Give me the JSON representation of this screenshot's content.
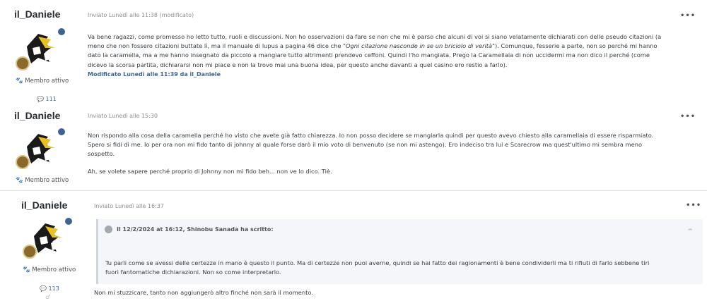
{
  "posts": [
    {
      "author": "il_Daniele",
      "group": "Membro attivo",
      "count": "111",
      "meta": "Inviato Lunedì alle 11:38 (modificato)",
      "paragraph1_a": "Va bene ragazzi, come promesso ho letto tutto, ruoli e discussioni. Non ho osservazioni da fare se non che mi è parso che alcuni di voi si siano velatamente dichiarati con delle pseudo citazioni (a",
      "paragraph1_b": "meno che non fossero citazioni buttate lì, ma il manuale di lupus a pagina 46 dice che \"",
      "paragraph1_italic": "Ogni citazione nasconde in se un briciolo di verità",
      "paragraph1_c": "\"). Comunque, fesserie a parte, non so perché mi hanno",
      "paragraph1_d": "dato la caramella, ma a me hanno insegnato da piccolo a mangiare tutto altrimenti prendevo ceffoni. Quindi l'ho mangiata. Prego la Caramellaia di non uccidermi ma non dico il perché (come",
      "paragraph1_e": "dicevo la scorsa partita, dichiararsi non mi piace e non la trovo mai una buona idea, per questo anche davanti a quel casino ero restio a farlo).",
      "modified": "Modificato Lunedì alle 11:39 da il_Daniele"
    },
    {
      "author": "il_Daniele",
      "group": "Membro attivo",
      "meta": "Inviato Lunedì alle 15:30",
      "line1": "Non rispondo alla cosa della caramella perché ho visto che avete già fatto chiarezza. Io non posso decidere se mangiarla quindi per questo avevo chiesto alla caramellaia di essere risparmiato.",
      "line2": "Spero si fidi di me. Io per ora non mi fido tanto di johnny al quale forse darò il mio voto di benvenuto (se non mi astengo). Ero indeciso tra lui e Scarecrow ma quest'ultimo mi sembra meno",
      "line3": "sospetto.",
      "line4": "Ah, se volete sapere perché proprio di Johnny non mi fido beh... non ve lo dico. Tiè."
    },
    {
      "author": "il_Daniele",
      "group": "Membro attivo",
      "count": "113",
      "meta": "Inviato Lunedì alle 16:37",
      "quote_head": "Il 12/2/2024 at 16:12, Shinobu Sanada ha scritto:",
      "quote_line1": "Tu parli come se avessi delle certezze in mano è questo il punto. Ma di certezze non puoi averne, quindi se hai fatto dei ragionamenti è bene condividerli ma ti rifiuti di farlo sebbene tiri",
      "quote_line2": "fuori fantomatiche dichiarazioni. Non so come interpretarlo.",
      "reply": "Non mi stuzzicare, tanto non aggiungerò altro finché non sarà il momento."
    }
  ],
  "ui": {
    "more_glyph": "•••",
    "comment_glyph": "💬",
    "paw_glyph": "🐾",
    "share_glyph": "➦",
    "gender_glyph": "♂"
  },
  "colors": {
    "accent": "#3d6594",
    "quote_bg": "#f4f6f9"
  }
}
